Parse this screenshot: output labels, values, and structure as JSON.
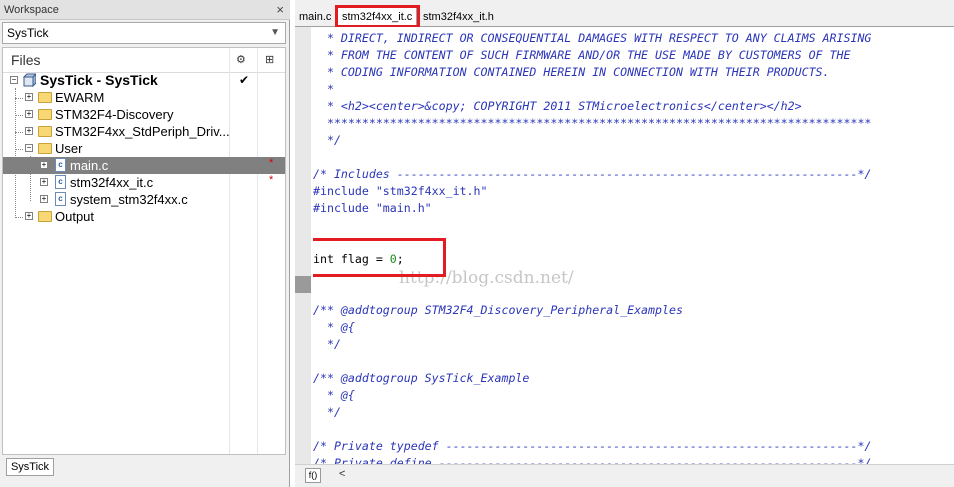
{
  "workspace": {
    "title": "Workspace",
    "close_glyph": "×",
    "config_selected": "SysTick",
    "files_header": "Files",
    "header_icons": [
      "settings-icon",
      "dependencies-icon"
    ],
    "bottom_tab": "SysTick",
    "tree": [
      {
        "label": "SysTick - SysTick",
        "type": "project",
        "bold": true,
        "checked": true
      },
      {
        "label": "EWARM",
        "type": "folder"
      },
      {
        "label": "STM32F4-Discovery",
        "type": "folder"
      },
      {
        "label": "STM32F4xx_StdPeriph_Driv...",
        "type": "folder"
      },
      {
        "label": "User",
        "type": "folder",
        "expanded": true
      },
      {
        "label": "main.c",
        "type": "c-file",
        "selected": true,
        "modified": true
      },
      {
        "label": "stm32f4xx_it.c",
        "type": "c-file",
        "modified": true
      },
      {
        "label": "system_stm32f4xx.c",
        "type": "c-file"
      },
      {
        "label": "Output",
        "type": "folder"
      }
    ]
  },
  "editor": {
    "tabs": [
      {
        "label": "main.c"
      },
      {
        "label": "stm32f4xx_it.c",
        "active": true
      },
      {
        "label": "stm32f4xx_it.h"
      }
    ],
    "code_lines": [
      "  * DIRECT, INDIRECT OR CONSEQUENTIAL DAMAGES WITH RESPECT TO ANY CLAIMS ARISING",
      "  * FROM THE CONTENT OF SUCH FIRMWARE AND/OR THE USE MADE BY CUSTOMERS OF THE",
      "  * CODING INFORMATION CONTAINED HEREIN IN CONNECTION WITH THEIR PRODUCTS.",
      "  *",
      "  * <h2><center>&copy; COPYRIGHT 2011 STMicroelectronics</center></h2>",
      "  ******************************************************************************",
      "  */",
      "",
      "/* Includes ------------------------------------------------------------------*/",
      "#include \"stm32f4xx_it.h\"",
      "#include \"main.h\"",
      "",
      "",
      "int flag = 0;",
      "",
      "",
      "/** @addtogroup STM32F4_Discovery_Peripheral_Examples",
      "  * @{",
      "  */",
      "",
      "/** @addtogroup SysTick_Example",
      "  * @{",
      "  */",
      "",
      "/* Private typedef -----------------------------------------------------------*/",
      "/* Private define ------------------------------------------------------------*/"
    ],
    "watermark": "http://blog.csdn.net/",
    "fo_label": "f()",
    "scroll_left_glyph": "<",
    "highlight_color": "#e31b23"
  }
}
